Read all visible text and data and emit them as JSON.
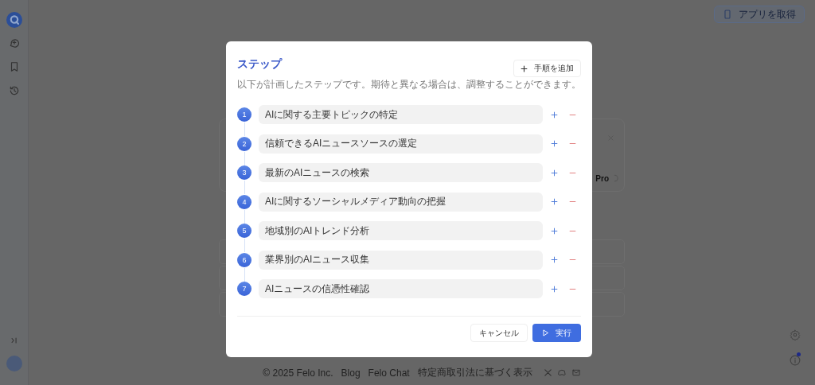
{
  "header": {
    "get_app_button": "アプリを取得"
  },
  "background_card": {
    "model_label": "Pro"
  },
  "dialog": {
    "title": "ステップ",
    "subtitle": "以下が計画したステップです。期待と異なる場合は、調整することができます。",
    "add_step_button": "手順を追加",
    "steps": [
      {
        "number": "1",
        "text": "AIに関する主要トピックの特定"
      },
      {
        "number": "2",
        "text": "信頼できるAIニュースソースの選定"
      },
      {
        "number": "3",
        "text": "最新のAIニュースの検索"
      },
      {
        "number": "4",
        "text": "AIに関するソーシャルメディア動向の把握"
      },
      {
        "number": "5",
        "text": "地域別のAIトレンド分析"
      },
      {
        "number": "6",
        "text": "業界別のAIニュース収集"
      },
      {
        "number": "7",
        "text": "AIニュースの信憑性確認"
      }
    ],
    "cancel_button": "キャンセル",
    "run_button": "実行"
  },
  "footer": {
    "links": [
      "© 2025  Felo Inc.",
      "Blog",
      "Felo Chat",
      "特定商取引法に基づく表示"
    ]
  }
}
